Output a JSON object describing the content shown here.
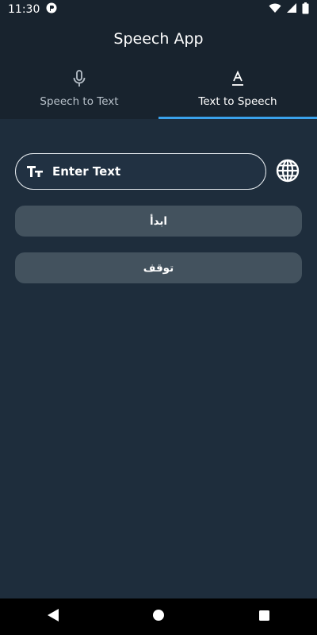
{
  "status_bar": {
    "time": "11:30",
    "icons": [
      "notification-app-icon",
      "wifi-icon",
      "signal-icon",
      "battery-icon"
    ]
  },
  "header": {
    "title": "Speech App"
  },
  "tabs": [
    {
      "label": "Speech to Text",
      "icon": "microphone-icon",
      "active": false
    },
    {
      "label": "Text to Speech",
      "icon": "text-format-icon",
      "active": true
    }
  ],
  "main": {
    "text_input": {
      "placeholder": "Enter Text",
      "value": "",
      "icon": "text-fields-icon"
    },
    "language_button": {
      "icon": "globe-icon"
    },
    "start_button_label": "ابدأ",
    "stop_button_label": "توقف"
  },
  "nav_bar": {
    "items": [
      "back-icon",
      "home-icon",
      "recents-icon"
    ]
  },
  "colors": {
    "background": "#1e2d3c",
    "header": "#18232e",
    "accent": "#3aa2ec",
    "button": "#43525e"
  }
}
